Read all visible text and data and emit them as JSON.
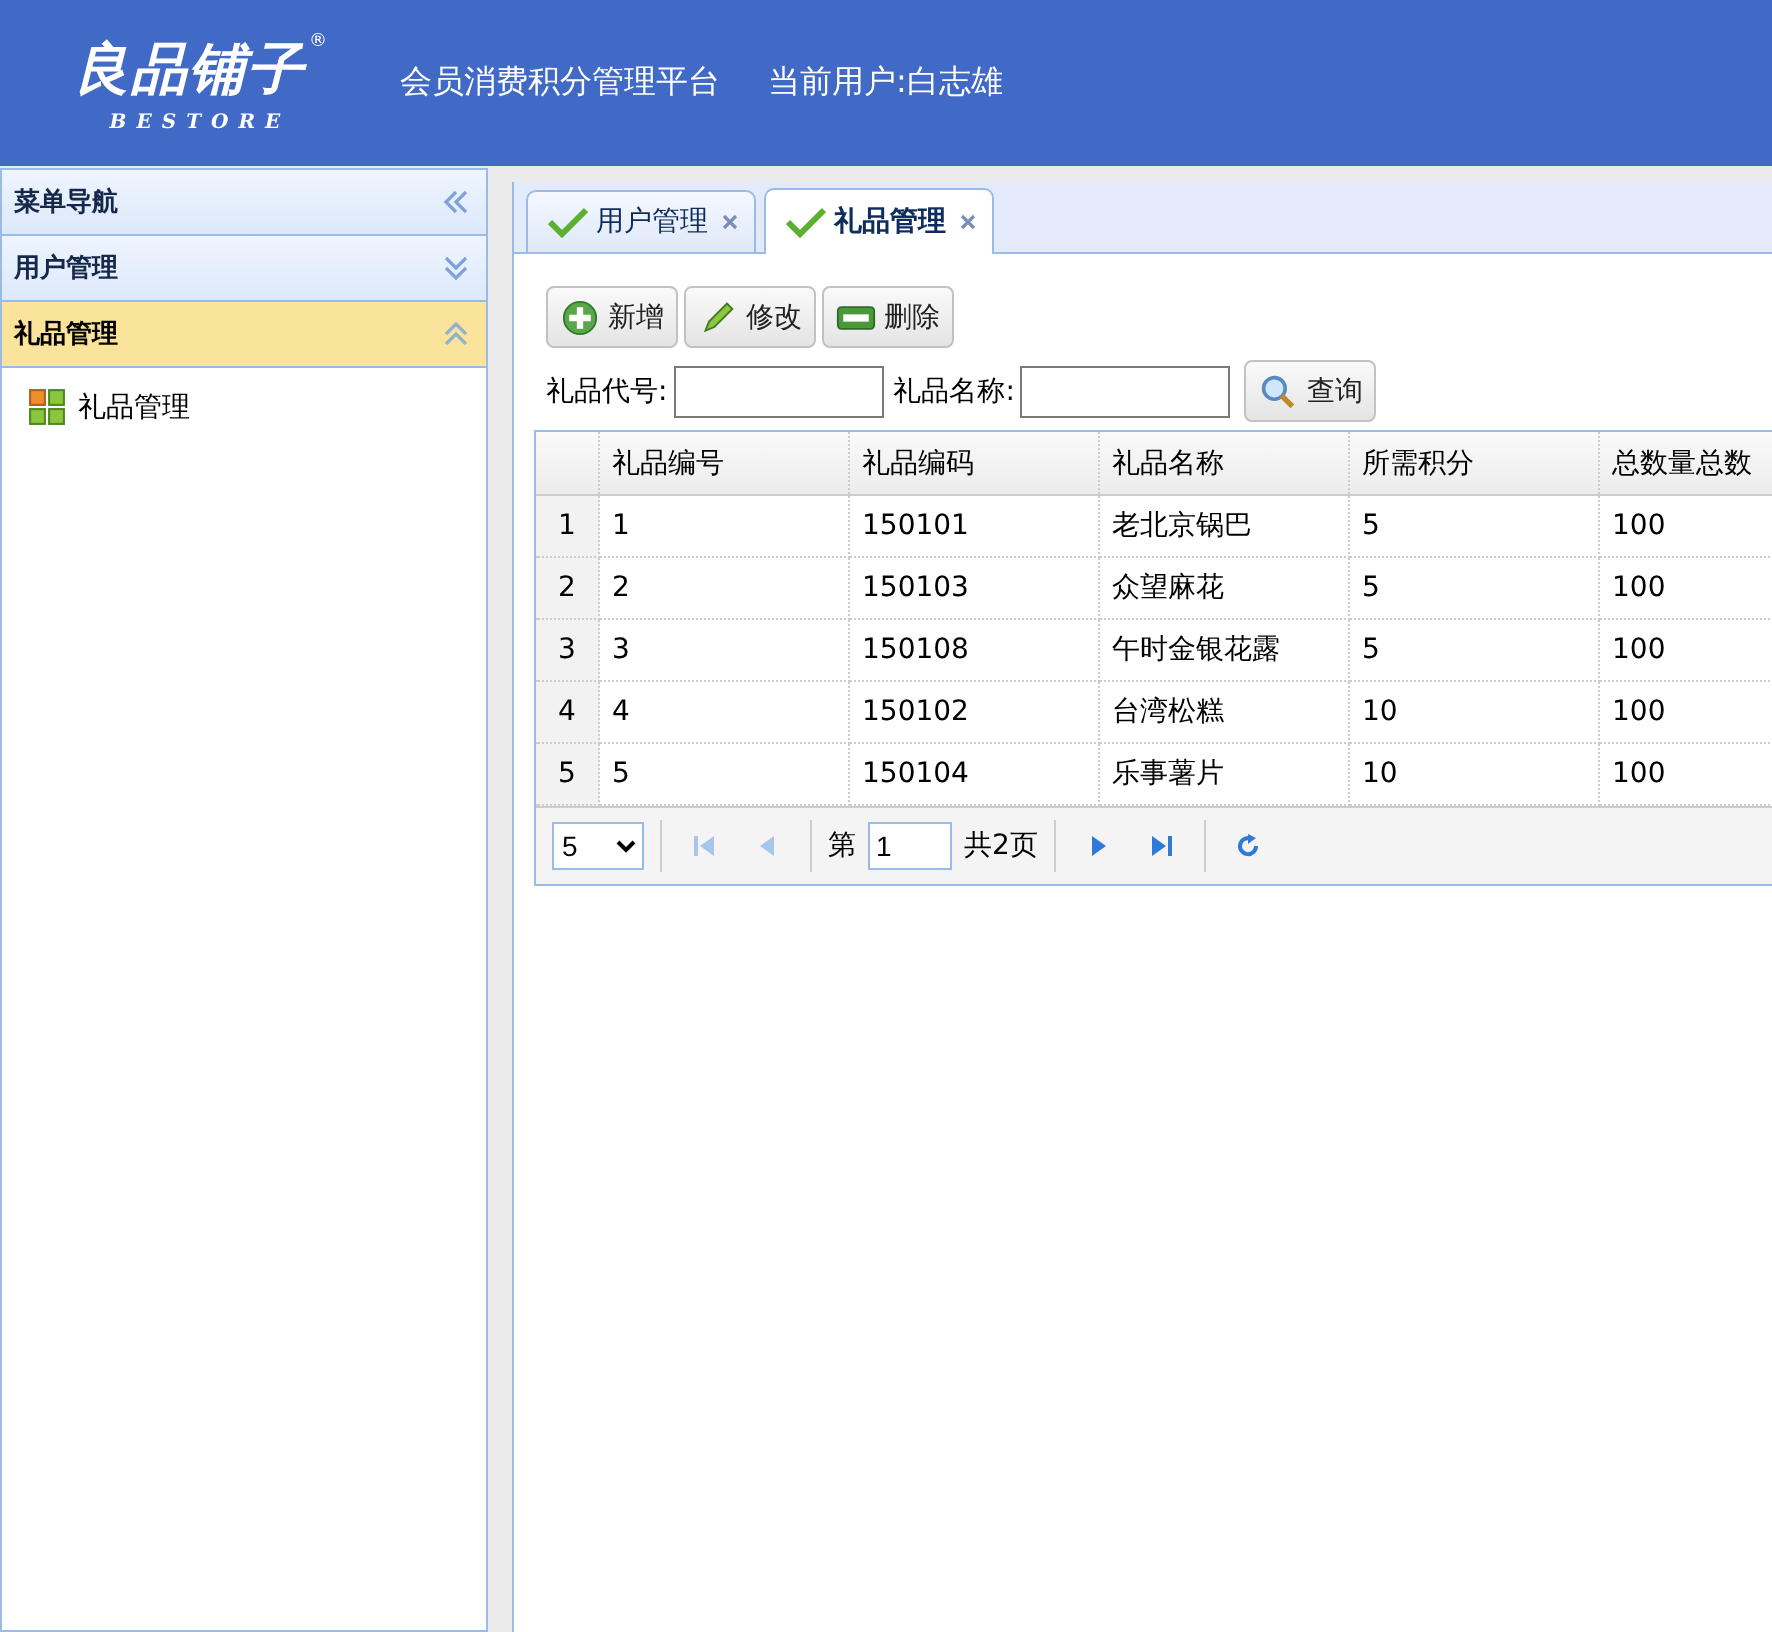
{
  "header": {
    "logo_title": "良品铺子",
    "logo_mark": "®",
    "logo_subtitle": "BESTORE",
    "platform_title": "会员消费积分管理平台",
    "current_user": "当前用户:白志雄"
  },
  "sidebar": {
    "title": "菜单导航",
    "sections": [
      {
        "label": "用户管理",
        "expanded": false
      },
      {
        "label": "礼品管理",
        "expanded": true,
        "items": [
          {
            "label": "礼品管理"
          }
        ]
      }
    ]
  },
  "tabs": [
    {
      "label": "用户管理",
      "selected": false
    },
    {
      "label": "礼品管理",
      "selected": true
    }
  ],
  "toolbar": [
    {
      "label": "新增",
      "kind": "add"
    },
    {
      "label": "修改",
      "kind": "edit"
    },
    {
      "label": "删除",
      "kind": "delete"
    }
  ],
  "search": {
    "fields": [
      {
        "label": "礼品代号:"
      },
      {
        "label": "礼品名称:"
      }
    ],
    "button": "查询"
  },
  "table": {
    "columns": [
      "礼品编号",
      "礼品编码",
      "礼品名称",
      "所需积分",
      "总数量总数"
    ],
    "rows": [
      {
        "row_number": "1",
        "cells": [
          "1",
          "150101",
          "老北京锅巴",
          "5",
          "100"
        ]
      },
      {
        "row_number": "2",
        "cells": [
          "2",
          "150103",
          "众望麻花",
          "5",
          "100"
        ]
      },
      {
        "row_number": "3",
        "cells": [
          "3",
          "150108",
          "午时金银花露",
          "5",
          "100"
        ]
      },
      {
        "row_number": "4",
        "cells": [
          "4",
          "150102",
          "台湾松糕",
          "10",
          "100"
        ]
      },
      {
        "row_number": "5",
        "cells": [
          "5",
          "150104",
          "乐事薯片",
          "10",
          "100"
        ]
      }
    ]
  },
  "pager": {
    "page_size": "5",
    "page_prefix": "第",
    "page_value": "1",
    "page_suffix": "共2页",
    "buttons": [
      {
        "kind": "first",
        "disabled": true
      },
      {
        "kind": "prev",
        "disabled": true
      },
      {
        "kind": "next",
        "disabled": false
      },
      {
        "kind": "last",
        "disabled": false
      },
      {
        "kind": "refresh",
        "disabled": false
      }
    ]
  }
}
